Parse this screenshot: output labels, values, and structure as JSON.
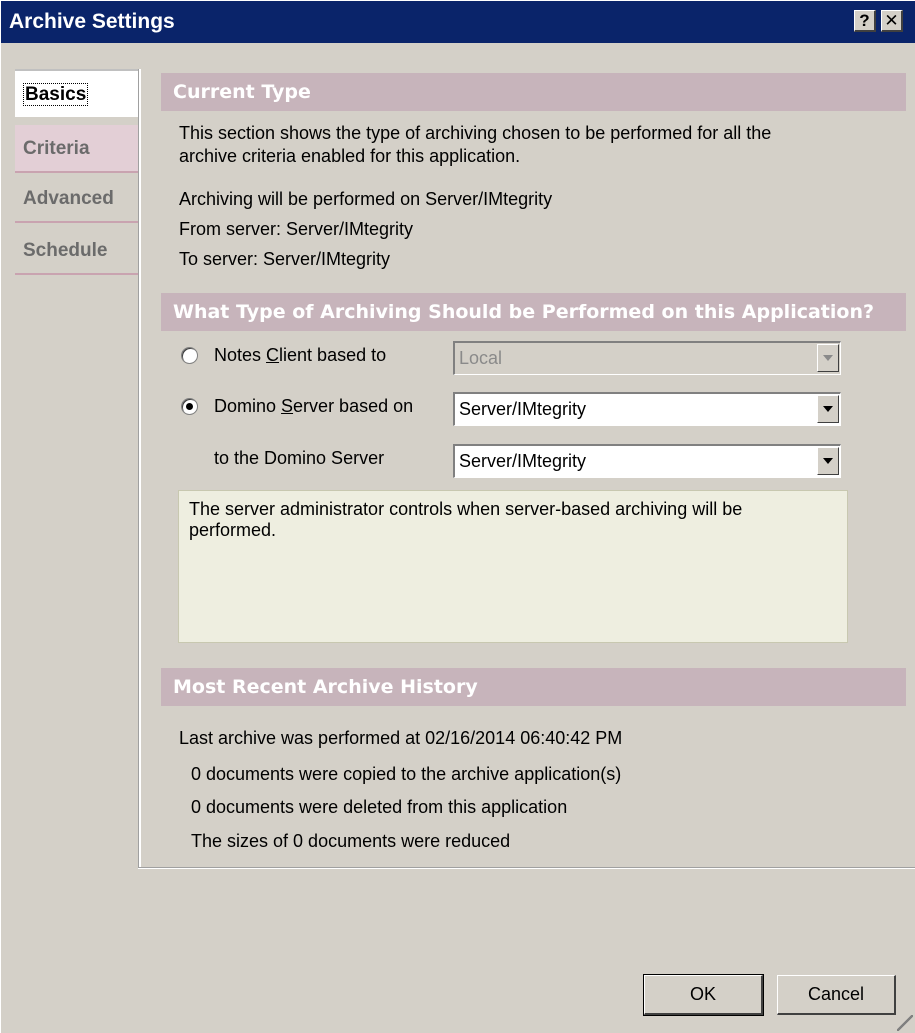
{
  "window": {
    "title": "Archive Settings",
    "help_label": "?",
    "close_label": "✕"
  },
  "tabs": [
    {
      "label": "Basics",
      "active": true
    },
    {
      "label": "Criteria",
      "active": false
    },
    {
      "label": "Advanced",
      "active": false
    },
    {
      "label": "Schedule",
      "active": false
    }
  ],
  "current_type": {
    "header": "Current Type",
    "description_line1": "This section shows the type of archiving chosen to be performed for all the",
    "description_line2": "archive criteria enabled for this application.",
    "performed_on": "Archiving will be performed on Server/IMtegrity",
    "from_server": "From server: Server/IMtegrity",
    "to_server": "To server: Server/IMtegrity"
  },
  "archiving_type": {
    "header": "What Type of Archiving Should be Performed on this Application?",
    "client_option": {
      "prefix": "Notes ",
      "accel": "C",
      "suffix": "lient based to",
      "selected": false
    },
    "client_select": {
      "value": "Local",
      "disabled": true
    },
    "server_option": {
      "prefix": "Domino ",
      "accel": "S",
      "suffix": "erver based on",
      "selected": true
    },
    "server_select": {
      "value": "Server/IMtegrity"
    },
    "to_label": "to the Domino Server",
    "to_select": {
      "value": "Server/IMtegrity"
    },
    "info_line1": "The server administrator controls when server-based archiving will be",
    "info_line2": "performed."
  },
  "history": {
    "header": "Most Recent Archive History",
    "last_performed": "Last archive was performed at 02/16/2014 06:40:42 PM",
    "copied": "0 documents were copied to the archive application(s)",
    "deleted": "0 documents were deleted from this application",
    "reduced": "The sizes of 0 documents were reduced"
  },
  "buttons": {
    "ok": "OK",
    "cancel": "Cancel"
  }
}
